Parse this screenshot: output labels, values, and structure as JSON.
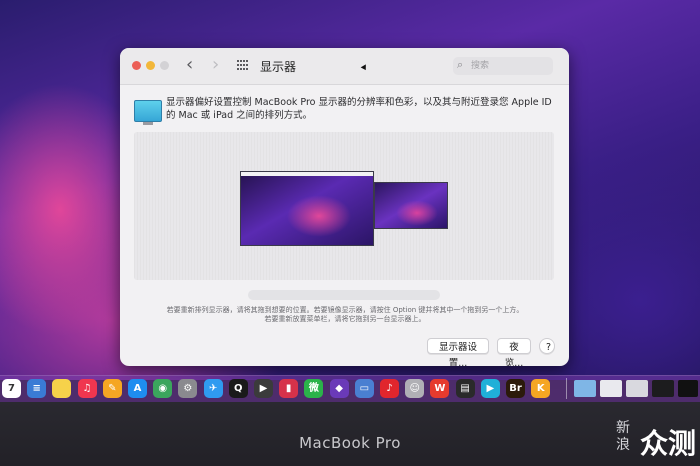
{
  "window": {
    "title": "显示器",
    "search_placeholder": "搜索",
    "nav_back_glyph": "‹",
    "nav_forward_glyph": "›",
    "description": "显示器偏好设置控制 MacBook Pro 显示器的分辨率和色彩，以及其与附近登录您 Apple ID 的 Mac 或 iPad 之间的排列方式。",
    "hint_line1": "若要重新排列显示器，请将其拖到想要的位置。若要镜像显示器，请按住 Option 键并将其中一个拖到另一个上方。",
    "hint_line2": "若要重新放置菜单栏，请将它拖到另一台显示器上。",
    "buttons": {
      "display_settings": "显示器设置...",
      "night_shift": "夜览...",
      "help": "?"
    }
  },
  "device": {
    "brand_label": "MacBook Pro"
  },
  "watermark": {
    "left_text": "新浪",
    "right_text": "众测"
  },
  "colors": {
    "close": "#ec5f57",
    "minimize": "#f2b73a",
    "window_bg": "#f2f1f3"
  },
  "dock": {
    "icons": [
      {
        "name": "calendar-icon",
        "glyph": "7",
        "color": "#ffffff"
      },
      {
        "name": "reminders-icon",
        "glyph": "≡",
        "color": "#3a7bd5"
      },
      {
        "name": "notes-icon",
        "glyph": "",
        "color": "#f6d24a"
      },
      {
        "name": "music-icon",
        "glyph": "♫",
        "color": "#f0364f"
      },
      {
        "name": "pages-icon",
        "glyph": "✎",
        "color": "#f5a623"
      },
      {
        "name": "app-store-icon",
        "glyph": "A",
        "color": "#1e8df0"
      },
      {
        "name": "chrome-icon",
        "glyph": "◉",
        "color": "#3ba55d"
      },
      {
        "name": "system-preferences-icon",
        "glyph": "⚙",
        "color": "#8a8a8f"
      },
      {
        "name": "testflight-icon",
        "glyph": "✈",
        "color": "#2f9bf0"
      },
      {
        "name": "qq-icon",
        "glyph": "Q",
        "color": "#1a1a1a"
      },
      {
        "name": "final-cut-icon",
        "glyph": "▶",
        "color": "#3b3b3b"
      },
      {
        "name": "toolbox-icon",
        "glyph": "▮",
        "color": "#d6324a"
      },
      {
        "name": "wechat-icon",
        "glyph": "微",
        "color": "#2bb34a"
      },
      {
        "name": "affinity-icon",
        "glyph": "◆",
        "color": "#6a3ab8"
      },
      {
        "name": "display-icon",
        "glyph": "▭",
        "color": "#4a7fd1"
      },
      {
        "name": "netease-icon",
        "glyph": "♪",
        "color": "#e1262d"
      },
      {
        "name": "robot-icon",
        "glyph": "☺",
        "color": "#b0b0b5"
      },
      {
        "name": "wps-icon",
        "glyph": "W",
        "color": "#e63b2e"
      },
      {
        "name": "film-icon",
        "glyph": "▤",
        "color": "#2a2a2a"
      },
      {
        "name": "infuse-icon",
        "glyph": "▶",
        "color": "#1fb0d8"
      },
      {
        "name": "bridge-icon",
        "glyph": "Br",
        "color": "#2b1a0a"
      },
      {
        "name": "keep-icon",
        "glyph": "K",
        "color": "#f5a623"
      }
    ]
  }
}
